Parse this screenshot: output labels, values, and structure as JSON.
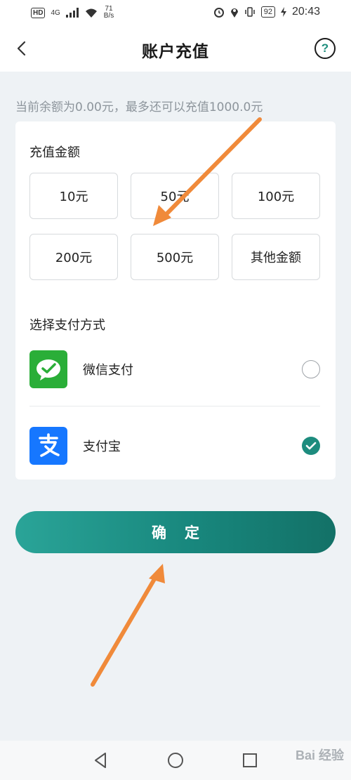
{
  "status_bar": {
    "hd": "HD",
    "network": "4G",
    "speed_value": "71",
    "speed_unit": "B/s",
    "battery": "92",
    "time": "20:43"
  },
  "header": {
    "title": "账户充值"
  },
  "balance_text": "当前余额为0.00元，最多还可以充值1000.0元",
  "recharge": {
    "section_title": "充值金额",
    "amounts": [
      "10元",
      "50元",
      "100元",
      "200元",
      "500元",
      "其他金额"
    ]
  },
  "payment": {
    "section_title": "选择支付方式",
    "methods": [
      {
        "label": "微信支付",
        "selected": false,
        "icon": "wechat-pay-icon",
        "color": "#2aae38"
      },
      {
        "label": "支付宝",
        "selected": true,
        "icon": "alipay-icon",
        "color": "#1677ff"
      }
    ]
  },
  "confirm_label": "确定",
  "watermark": "Bai 经验",
  "colors": {
    "accent": "#1d8c7e",
    "annotation_arrow": "#f08a3a"
  }
}
